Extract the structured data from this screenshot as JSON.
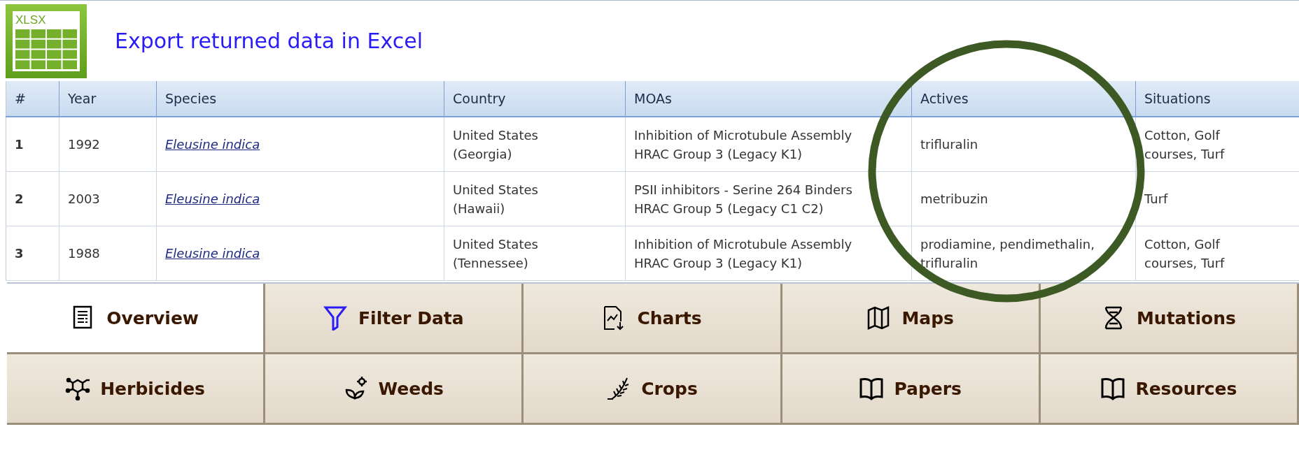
{
  "export": {
    "icon_label": "XLSX",
    "title": "Export returned data in Excel"
  },
  "table": {
    "columns": [
      "#",
      "Year",
      "Species",
      "Country",
      "MOAs",
      "Actives",
      "Situations"
    ],
    "rows": [
      {
        "index": "1",
        "year": "1992",
        "species": "Eleusine indica",
        "country": [
          "United States",
          "(Georgia)"
        ],
        "moas": [
          "Inhibition of Microtubule Assembly",
          "HRAC Group 3 (Legacy K1)"
        ],
        "actives": "trifluralin",
        "situations": "Cotton, Golf courses, Turf"
      },
      {
        "index": "2",
        "year": "2003",
        "species": "Eleusine indica",
        "country": [
          "United States",
          "(Hawaii)"
        ],
        "moas": [
          "PSII inhibitors - Serine 264 Binders",
          "HRAC Group 5 (Legacy C1 C2)"
        ],
        "actives": "metribuzin",
        "situations": "Turf"
      },
      {
        "index": "3",
        "year": "1988",
        "species": "Eleusine indica",
        "country": [
          "United States",
          "(Tennessee)"
        ],
        "moas": [
          "Inhibition of Microtubule Assembly",
          "HRAC Group 3 (Legacy K1)"
        ],
        "actives": "prodiamine, pendimethalin, trifluralin",
        "situations": "Cotton, Golf courses, Turf"
      }
    ]
  },
  "nav": [
    {
      "label": "Overview",
      "selected": true
    },
    {
      "label": "Filter Data",
      "selected": false
    },
    {
      "label": "Charts",
      "selected": false
    },
    {
      "label": "Maps",
      "selected": false
    },
    {
      "label": "Mutations",
      "selected": false
    },
    {
      "label": "Herbicides",
      "selected": false
    },
    {
      "label": "Weeds",
      "selected": false
    },
    {
      "label": "Crops",
      "selected": false
    },
    {
      "label": "Papers",
      "selected": false
    },
    {
      "label": "Resources",
      "selected": false
    }
  ],
  "annotation": {
    "kind": "ellipse",
    "color": "#3d5a24"
  }
}
